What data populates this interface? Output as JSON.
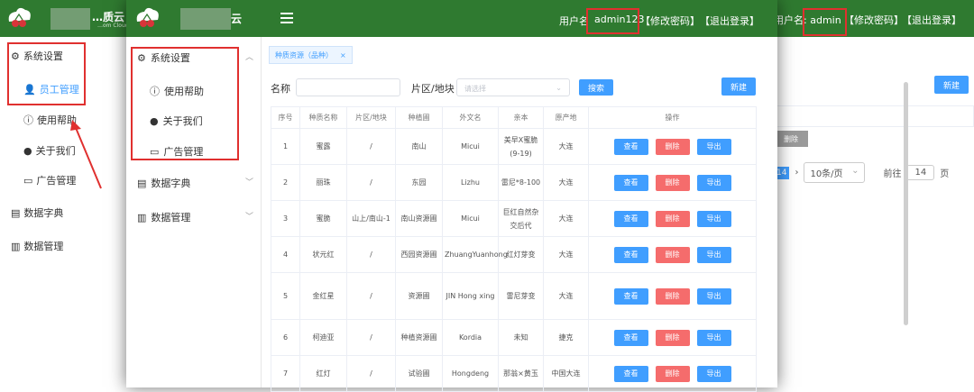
{
  "bg_app": {
    "title": "…质云",
    "subtitle": "…om Cloud",
    "user_label": "用户名:",
    "user_name": "admin",
    "change_pw": "【修改密码】",
    "logout": "【退出登录】",
    "sidebar": {
      "system": "系统设置",
      "staff": "员工管理",
      "help": "使用帮助",
      "about": "关于我们",
      "ads": "广告管理",
      "dict": "数据字典",
      "data": "数据管理"
    },
    "new_btn": "新建",
    "del_btn": "删除",
    "pager": {
      "current": "14",
      "size": "10条/页",
      "goto": "前往",
      "page_input": "14",
      "page_suffix": "页"
    }
  },
  "fg_app": {
    "title": "云",
    "user_label": "用户名",
    "user_name": "admin123",
    "change_pw": "【修改密码】",
    "logout": "【退出登录】",
    "sidebar": {
      "system": "系统设置",
      "help": "使用帮助",
      "about": "关于我们",
      "ads": "广告管理",
      "dict": "数据字典",
      "data": "数据管理"
    },
    "tab": "种质资源（品种）",
    "filter": {
      "name_label": "名称",
      "area_label": "片区/地块",
      "area_placeholder": "请选择",
      "search": "搜索",
      "new": "新建"
    },
    "table": {
      "headers": [
        "序号",
        "种质名称",
        "片区/地块",
        "种植圃",
        "外文名",
        "亲本",
        "原产地",
        "操作"
      ],
      "rows": [
        [
          "1",
          "蜜露",
          "/",
          "南山",
          "Micui",
          "美早X蜜脆(9-19)",
          "大连"
        ],
        [
          "2",
          "丽珠",
          "/",
          "东园",
          "Lizhu",
          "雷尼*8-100",
          "大连"
        ],
        [
          "3",
          "蜜脆",
          "山上/南山-1",
          "南山资源圃",
          "Micui",
          "巨红自然杂交后代",
          "大连"
        ],
        [
          "4",
          "状元红",
          "/",
          "西园资源圃",
          "ZhuangYuanhong",
          "红灯芽变",
          "大连"
        ],
        [
          "5",
          "金红星",
          "/",
          "资源圃",
          "JIN Hong xing",
          "雷尼芽变",
          "大连"
        ],
        [
          "6",
          "柯迪亚",
          "/",
          "种植资源圃",
          "Kordia",
          "未知",
          "捷克"
        ],
        [
          "7",
          "红灯",
          "/",
          "试验圃",
          "Hongdeng",
          "那翁×黄玉",
          "中国大连"
        ]
      ],
      "ops": {
        "view": "查看",
        "delete": "删除",
        "export": "导出"
      }
    }
  },
  "colors": {
    "header": "#2f7a30",
    "primary": "#409eff",
    "danger": "#f56c6c",
    "annotation": "#e0302f"
  }
}
